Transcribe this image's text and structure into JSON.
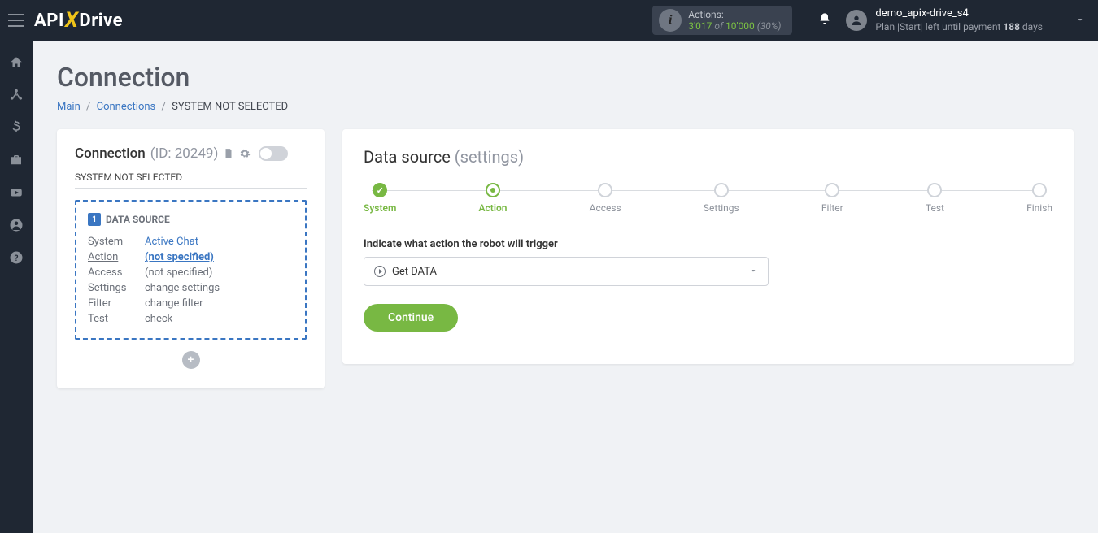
{
  "header": {
    "logo": {
      "api": "API",
      "x": "X",
      "drive": "Drive"
    },
    "actions": {
      "label": "Actions:",
      "used": "3'017",
      "of": "of",
      "total": "10'000",
      "pct": "(30%)"
    },
    "user": {
      "name": "demo_apix-drive_s4",
      "plan_prefix": "Plan |Start| left until payment ",
      "days": "188",
      "plan_suffix": " days"
    }
  },
  "page": {
    "title": "Connection",
    "breadcrumb": {
      "main": "Main",
      "connections": "Connections",
      "current": "SYSTEM NOT SELECTED"
    }
  },
  "left": {
    "conn_label": "Connection ",
    "conn_id": "(ID: 20249)",
    "sub": "SYSTEM NOT SELECTED",
    "ds_badge": "1",
    "ds_title": "DATA SOURCE",
    "rows": {
      "system_k": "System",
      "system_v": "Active Chat",
      "action_k": "Action",
      "action_v": "(not specified)",
      "access_k": "Access",
      "access_v": "(not specified)",
      "settings_k": "Settings",
      "settings_v": "change settings",
      "filter_k": "Filter",
      "filter_v": "change filter",
      "test_k": "Test",
      "test_v": "check"
    },
    "add": "+"
  },
  "right": {
    "title": "Data source ",
    "title_muted": "(settings)",
    "steps": [
      "System",
      "Action",
      "Access",
      "Settings",
      "Filter",
      "Test",
      "Finish"
    ],
    "form_label": "Indicate what action the robot will trigger",
    "select_value": "Get DATA",
    "continue": "Continue"
  }
}
